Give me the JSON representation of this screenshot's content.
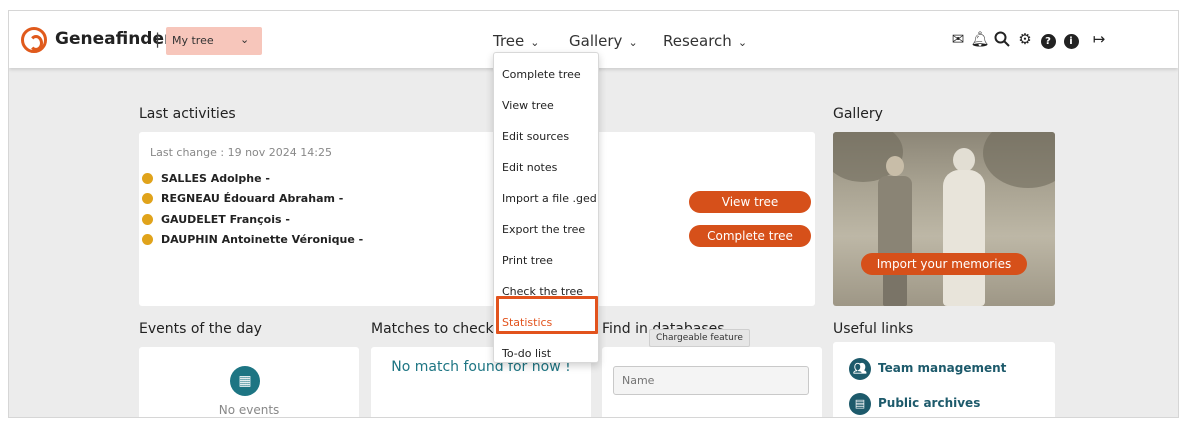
{
  "header": {
    "brand": "Geneafinder",
    "separator": "|",
    "tree_selector": "My tree",
    "menu": [
      {
        "label": "Tree"
      },
      {
        "label": "Gallery"
      },
      {
        "label": "Research"
      }
    ],
    "icons": [
      "mail-icon",
      "bell-icon",
      "search-icon",
      "gear-icon",
      "help-icon",
      "info-icon",
      "logout-icon"
    ]
  },
  "tree_menu": {
    "items": [
      "Complete tree",
      "View tree",
      "Edit sources",
      "Edit notes",
      "Import a file .ged",
      "Export the tree",
      "Print tree",
      "Check the tree",
      "Statistics",
      "To-do list"
    ],
    "highlighted": "Statistics",
    "tooltip": "Chargeable feature"
  },
  "last_activities": {
    "title": "Last activities",
    "last_change": "Last change : 19 nov 2024 14:25",
    "people": [
      "SALLES Adolphe -",
      "REGNEAU Édouard Abraham -",
      "GAUDELET François -",
      "DAUPHIN Antoinette Véronique -"
    ],
    "view_tree_button": "View tree",
    "complete_tree_button": "Complete tree"
  },
  "gallery": {
    "title": "Gallery",
    "import_button": "Import your memories"
  },
  "events": {
    "title": "Events of the day",
    "empty": "No events"
  },
  "matches": {
    "title": "Matches to check",
    "empty": "No match found for now !"
  },
  "find": {
    "title": "Find in databases",
    "name_placeholder": "Name"
  },
  "useful_links": {
    "title": "Useful links",
    "items": [
      "Team management",
      "Public archives"
    ]
  },
  "colors": {
    "accent": "#d6501a",
    "teal": "#1d7583",
    "tree_selector_bg": "#f7c6bb",
    "activity_dot": "#e0a31b"
  }
}
